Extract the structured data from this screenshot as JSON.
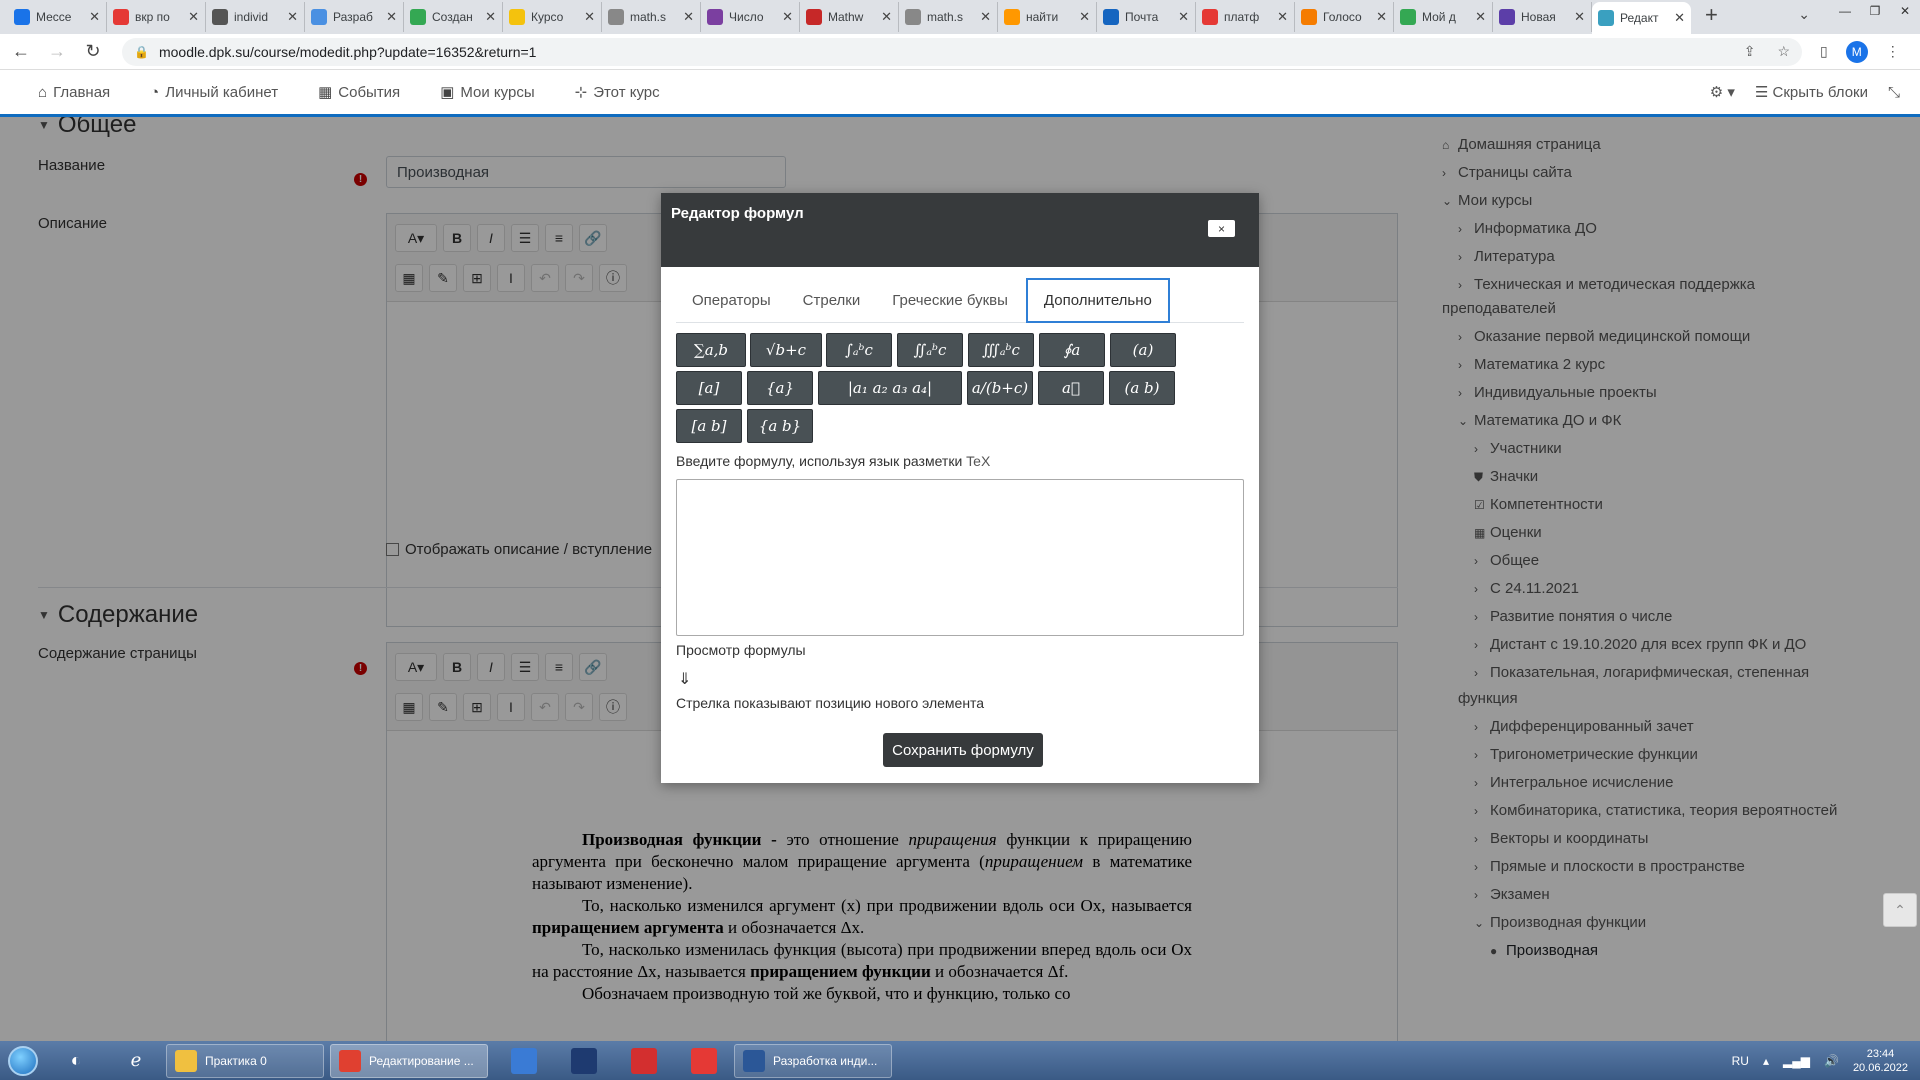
{
  "browser": {
    "tabs": [
      {
        "title": "Мессе",
        "color": "#1a73e8"
      },
      {
        "title": "вкр по",
        "color": "#e53935"
      },
      {
        "title": "individ",
        "color": "#555555"
      },
      {
        "title": "Разраб",
        "color": "#4a90e2"
      },
      {
        "title": "Создан",
        "color": "#34a853"
      },
      {
        "title": "Курсо",
        "color": "#f4c20d"
      },
      {
        "title": "math.s",
        "color": "#888888"
      },
      {
        "title": "Число",
        "color": "#7b3fa0"
      },
      {
        "title": "Mathw",
        "color": "#c62828"
      },
      {
        "title": "math.s",
        "color": "#888888"
      },
      {
        "title": "найти",
        "color": "#ff9800"
      },
      {
        "title": "Почта",
        "color": "#1565c0"
      },
      {
        "title": "платф",
        "color": "#e53935"
      },
      {
        "title": "Голосо",
        "color": "#f57c00"
      },
      {
        "title": "Мой д",
        "color": "#34a853"
      },
      {
        "title": "Новая",
        "color": "#5c3ea8"
      },
      {
        "title": "Редакт",
        "color": "#3aa0c0"
      }
    ],
    "url": "moodle.dpk.su/course/modedit.php?update=16352&return=1",
    "profile_initial": "M"
  },
  "navbar": {
    "home": "Главная",
    "dashboard": "Личный кабинет",
    "events": "События",
    "my_courses": "Мои курсы",
    "this_course": "Этот курс",
    "hide_blocks": "Скрыть блоки"
  },
  "form": {
    "general_heading": "Общее",
    "name_label": "Название",
    "name_value": "Производная",
    "description_label": "Описание",
    "show_description": "Отображать описание / вступление",
    "content_heading": "Содержание",
    "page_content_label": "Содержание страницы"
  },
  "document": {
    "p1_bold": "Производная функции -",
    "p1_a": " это отношение ",
    "p1_i1": "приращения",
    "p1_b": " функции к приращению аргумента при бесконечно малом приращение аргумента (",
    "p1_i2": "приращением",
    "p1_c": " в математике называют изменение).",
    "p2_a": "То, насколько изменился аргумент (x) при продвижении вдоль оси Ox, называется ",
    "p2_bold": "приращением аргумента",
    "p2_b": " и обозначается Δx.",
    "p3_a": "То, насколько изменилась функция (высота) при продвижении вперед вдоль оси Ox на расстояние Δx, называется ",
    "p3_bold": "приращением функции",
    "p3_b": " и обозначается Δf.",
    "p4": "Обозначаем производную той же буквой, что и функцию, только со"
  },
  "sidebar": {
    "items": [
      {
        "label": "Домашняя страница",
        "icon": "home-icon"
      },
      {
        "label": "Страницы сайта",
        "icon": "chevron-right-icon"
      },
      {
        "label": "Мои курсы",
        "icon": "chevron-down-icon"
      },
      {
        "label": "Информатика ДО",
        "icon": "chevron-right-icon"
      },
      {
        "label": "Литература",
        "icon": "chevron-right-icon"
      },
      {
        "label": "Техническая и методическая поддержка",
        "icon": "chevron-right-icon"
      },
      {
        "label": "преподавателей",
        "icon": ""
      },
      {
        "label": "Оказание первой медицинской помощи",
        "icon": "chevron-right-icon"
      },
      {
        "label": "Математика 2 курс",
        "icon": "chevron-right-icon"
      },
      {
        "label": "Индивидуальные проекты",
        "icon": "chevron-right-icon"
      },
      {
        "label": "Математика ДО и ФК",
        "icon": "chevron-down-icon"
      },
      {
        "label": "Участники",
        "icon": "chevron-right-icon"
      },
      {
        "label": "Значки",
        "icon": "shield-icon"
      },
      {
        "label": "Компетентности",
        "icon": "checkbox-icon"
      },
      {
        "label": "Оценки",
        "icon": "table-icon"
      },
      {
        "label": "Общее",
        "icon": "chevron-right-icon"
      },
      {
        "label": "С 24.11.2021",
        "icon": "chevron-right-icon"
      },
      {
        "label": "Развитие понятия о числе",
        "icon": "chevron-right-icon"
      },
      {
        "label": "Дистант с 19.10.2020 для всех групп ФК и ДО",
        "icon": "chevron-right-icon"
      },
      {
        "label": "Показательная, логарифмическая, степенная",
        "icon": "chevron-right-icon"
      },
      {
        "label": "функция",
        "icon": ""
      },
      {
        "label": "Дифференцированный зачет",
        "icon": "chevron-right-icon"
      },
      {
        "label": "Тригонометрические функции",
        "icon": "chevron-right-icon"
      },
      {
        "label": "Интегральное исчисление",
        "icon": "chevron-right-icon"
      },
      {
        "label": "Комбинаторика, статистика, теория вероятностей",
        "icon": "chevron-right-icon"
      },
      {
        "label": "Векторы и координаты",
        "icon": "chevron-right-icon"
      },
      {
        "label": "Прямые и плоскости в пространстве",
        "icon": "chevron-right-icon"
      },
      {
        "label": "Экзамен",
        "icon": "chevron-right-icon"
      },
      {
        "label": "Производная функции",
        "icon": "chevron-down-icon"
      },
      {
        "label": "Производная",
        "icon": "page-icon"
      }
    ]
  },
  "dialog": {
    "title": "Редактор формул",
    "close": "×",
    "tabs": [
      "Операторы",
      "Стрелки",
      "Греческие буквы",
      "Дополнительно"
    ],
    "active_tab": "Дополнительно",
    "buttons": [
      "∑a,b",
      "√b+c",
      "∫ₐᵇc",
      "∬ₐᵇc",
      "∭ₐᵇc",
      "∮a",
      "(a)",
      "[a]",
      "{a}",
      "|a₁  a₂ a₃  a₄|",
      "a/(b+c)",
      "a⃗",
      "(a b)",
      "[a b]",
      "{a b}"
    ],
    "tex_label": "Введите формулу, используя язык разметки",
    "tex_word": "TeX",
    "tex_value": "",
    "preview_label": "Просмотр формулы",
    "arrow": "⇓",
    "hint": "Стрелка показывают позицию нового элемента",
    "save": "Сохранить формулу"
  },
  "taskbar": {
    "windows": [
      {
        "label": "Практика 0",
        "color": "#f0c040"
      },
      {
        "label": "Редактирование ...",
        "color": "#e04030"
      },
      {
        "label": "",
        "color": "#3a7bd5"
      },
      {
        "label": "",
        "color": "#1e3a70"
      },
      {
        "label": "",
        "color": "#d32f2f"
      },
      {
        "label": "",
        "color": "#e53935"
      },
      {
        "label": "Разработка инди...",
        "color": "#2b5797"
      }
    ],
    "lang": "RU",
    "time": "23:44",
    "date": "20.06.2022"
  }
}
